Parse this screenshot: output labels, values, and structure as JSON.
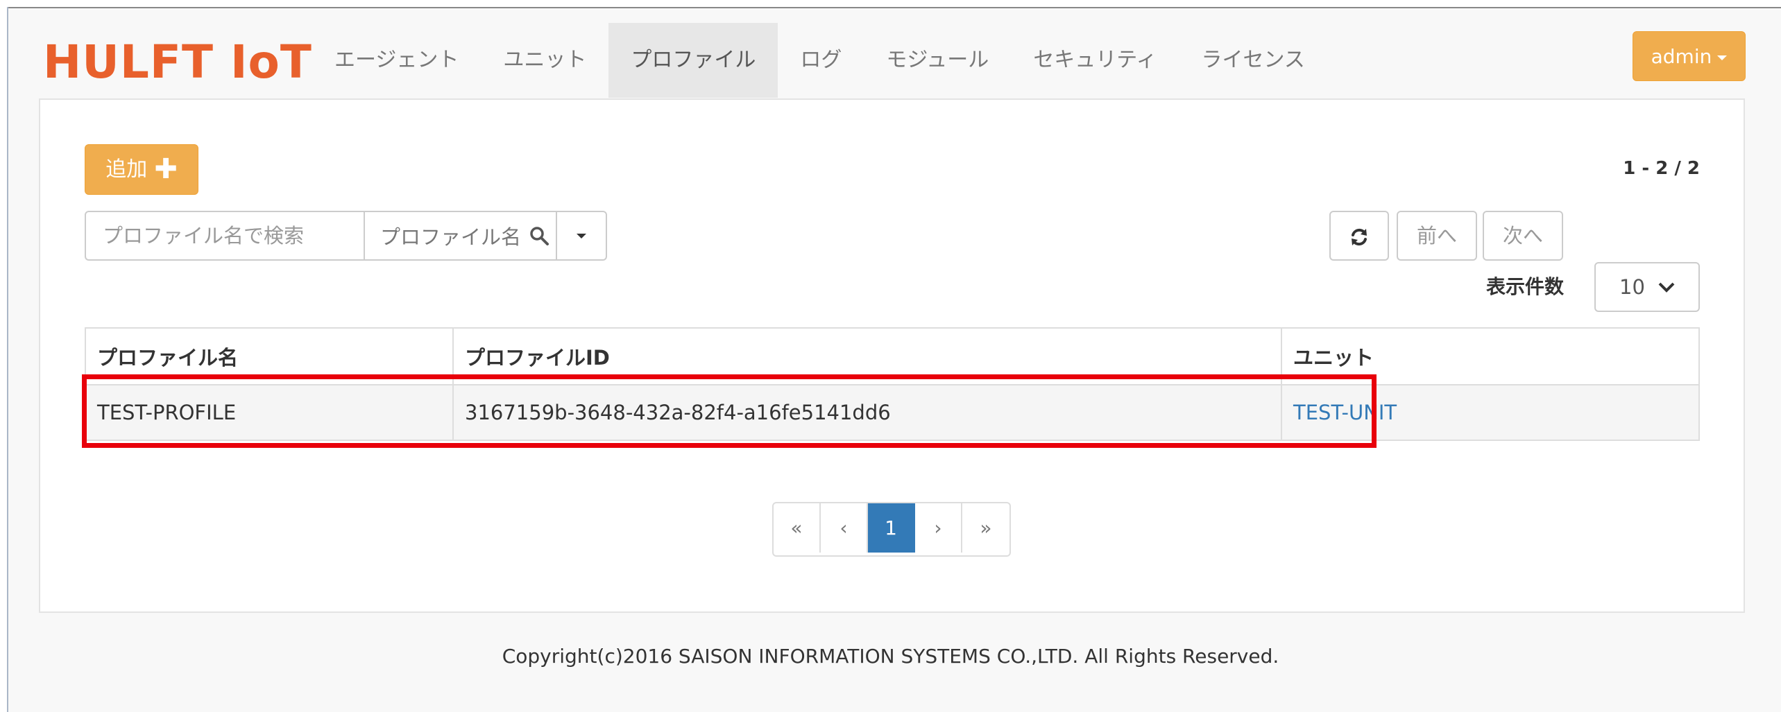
{
  "brand": {
    "logo_text": "HULFT IoT",
    "logo_color": "#e8602c"
  },
  "nav": {
    "items": [
      {
        "label": "エージェント"
      },
      {
        "label": "ユニット"
      },
      {
        "label": "プロファイル",
        "active": true
      },
      {
        "label": "ログ"
      },
      {
        "label": "モジュール"
      },
      {
        "label": "セキュリティ"
      },
      {
        "label": "ライセンス"
      }
    ],
    "user_menu_label": "admin"
  },
  "toolbar": {
    "add_label": "追加",
    "add_icon": "plus-icon",
    "record_count": "1 - 2 / 2",
    "search_placeholder": "プロファイル名で検索",
    "search_field_label": "プロファイル名",
    "search_icon": "search-icon",
    "refresh_icon": "refresh-icon",
    "prev_label": "前へ",
    "next_label": "次へ",
    "per_page_label": "表示件数",
    "per_page_value": "10"
  },
  "table": {
    "headers": [
      "プロファイル名",
      "プロファイルID",
      "ユニット"
    ],
    "rows": [
      {
        "name": "TEST-PROFILE",
        "id": "3167159b-3648-432a-82f4-a16fe5141dd6",
        "unit": "TEST-UNIT"
      }
    ]
  },
  "pagination": {
    "first": "«",
    "prev": "‹",
    "current": "1",
    "next": "›",
    "last": "»"
  },
  "footer": {
    "copyright": "Copyright(c)2016 SAISON INFORMATION SYSTEMS CO.,LTD. All Rights Reserved."
  },
  "colors": {
    "accent": "#f0ad4e",
    "link": "#337ab7",
    "highlight": "#e8000b",
    "active_page": "#337ab7"
  }
}
